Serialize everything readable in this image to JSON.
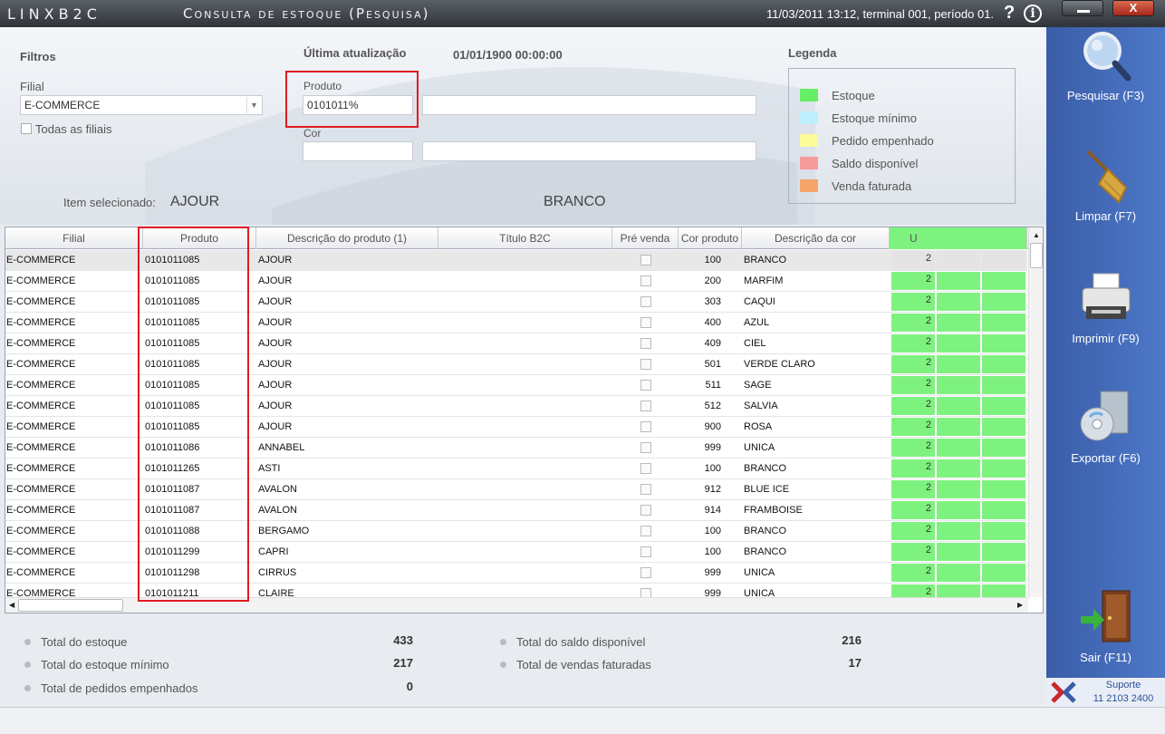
{
  "window": {
    "brand": "LINXB2C",
    "title": "Consulta de estoque (Pesquisa)",
    "status": "11/03/2011 13:12, terminal 001, período 01.",
    "help": "?",
    "info": "i",
    "close": "X"
  },
  "filters": {
    "title": "Filtros",
    "filial_label": "Filial",
    "filial_value": "E-COMMERCE",
    "todas_filiais": "Todas as filiais",
    "ultima_label": "Última atualização",
    "ultima_value": "01/01/1900 00:00:00",
    "produto_label": "Produto",
    "produto_value": "0101011%",
    "produto_desc": "",
    "cor_label": "Cor",
    "cor_value": "",
    "cor_desc": "",
    "item_label": "Item selecionado:",
    "item_product": "AJOUR",
    "item_color": "BRANCO"
  },
  "legend": {
    "title": "Legenda",
    "items": [
      {
        "label": "Estoque",
        "color": "#66ee66"
      },
      {
        "label": "Estoque mínimo",
        "color": "#bdeefb"
      },
      {
        "label": "Pedido empenhado",
        "color": "#fbfb9a"
      },
      {
        "label": "Saldo disponível",
        "color": "#f79a9a"
      },
      {
        "label": "Venda faturada",
        "color": "#f7a46a"
      }
    ]
  },
  "grid": {
    "columns": [
      "Filial",
      "Produto",
      "Descrição do produto (1)",
      "Título B2C",
      "Pré venda",
      "Cor produto",
      "Descrição da cor",
      "U"
    ],
    "rows": [
      [
        "E-COMMERCE",
        "0101011085",
        "AJOUR",
        "",
        "100",
        "BRANCO",
        "2"
      ],
      [
        "E-COMMERCE",
        "0101011085",
        "AJOUR",
        "",
        "200",
        "MARFIM",
        "2"
      ],
      [
        "E-COMMERCE",
        "0101011085",
        "AJOUR",
        "",
        "303",
        "CAQUI",
        "2"
      ],
      [
        "E-COMMERCE",
        "0101011085",
        "AJOUR",
        "",
        "400",
        "AZUL",
        "2"
      ],
      [
        "E-COMMERCE",
        "0101011085",
        "AJOUR",
        "",
        "409",
        "CIEL",
        "2"
      ],
      [
        "E-COMMERCE",
        "0101011085",
        "AJOUR",
        "",
        "501",
        "VERDE CLARO",
        "2"
      ],
      [
        "E-COMMERCE",
        "0101011085",
        "AJOUR",
        "",
        "511",
        "SAGE",
        "2"
      ],
      [
        "E-COMMERCE",
        "0101011085",
        "AJOUR",
        "",
        "512",
        "SALVIA",
        "2"
      ],
      [
        "E-COMMERCE",
        "0101011085",
        "AJOUR",
        "",
        "900",
        "ROSA",
        "2"
      ],
      [
        "E-COMMERCE",
        "0101011086",
        "ANNABEL",
        "",
        "999",
        "UNICA",
        "2"
      ],
      [
        "E-COMMERCE",
        "0101011265",
        "ASTI",
        "",
        "100",
        "BRANCO",
        "2"
      ],
      [
        "E-COMMERCE",
        "0101011087",
        "AVALON",
        "",
        "912",
        "BLUE ICE",
        "2"
      ],
      [
        "E-COMMERCE",
        "0101011087",
        "AVALON",
        "",
        "914",
        "FRAMBOISE",
        "2"
      ],
      [
        "E-COMMERCE",
        "0101011088",
        "BERGAMO",
        "",
        "100",
        "BRANCO",
        "2"
      ],
      [
        "E-COMMERCE",
        "0101011299",
        "CAPRI",
        "",
        "100",
        "BRANCO",
        "2"
      ],
      [
        "E-COMMERCE",
        "0101011298",
        "CIRRUS",
        "",
        "999",
        "UNICA",
        "2"
      ],
      [
        "E-COMMERCE",
        "0101011211",
        "CLAIRE",
        "",
        "999",
        "UNICA",
        "2"
      ]
    ]
  },
  "totals": {
    "estoque_label": "Total do estoque",
    "estoque_value": "433",
    "minimo_label": "Total do estoque mínimo",
    "minimo_value": "217",
    "pedidos_label": "Total de pedidos empenhados",
    "pedidos_value": "0",
    "saldo_label": "Total do saldo disponível",
    "saldo_value": "216",
    "vendas_label": "Total de vendas faturadas",
    "vendas_value": "17"
  },
  "sidebar": {
    "pesquisar": "Pesquisar (F3)",
    "limpar": "Limpar (F7)",
    "imprimir": "Imprimir (F9)",
    "exportar": "Exportar (F6)",
    "sair": "Sair (F11)",
    "support_label": "Suporte",
    "support_phone": "11 2103 2400"
  },
  "colors": {
    "accent": "#3a5da8",
    "highlight": "#e01b22",
    "stock_green": "#7ef27e"
  }
}
